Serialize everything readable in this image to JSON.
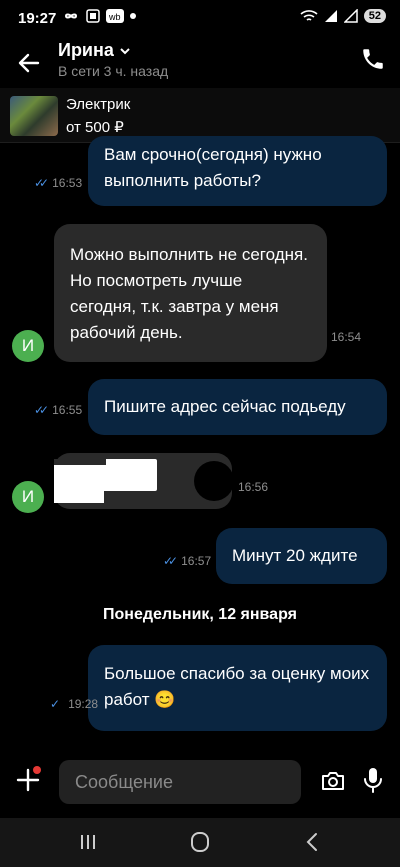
{
  "status_bar": {
    "time": "19:27",
    "battery": "52"
  },
  "header": {
    "name": "Ирина",
    "status": "В сети 3 ч. назад"
  },
  "listing": {
    "title": "Электрик",
    "price": "от 500 ₽"
  },
  "messages": [
    {
      "direction": "out",
      "text": "Вам срочно(сегодня) нужно выполнить работы?",
      "time": "16:53",
      "read": true
    },
    {
      "direction": "in",
      "text": "Можно выполнить не сегодня. Но посмотреть лучше сегодня, т.к. завтра у меня рабочий день.",
      "time": "16:54",
      "avatar": "И"
    },
    {
      "direction": "out",
      "text": "Пишите адрес сейчас подьеду",
      "time": "16:55",
      "read": true
    },
    {
      "direction": "in",
      "text": "",
      "time": "16:56",
      "avatar": "И",
      "redacted": true
    },
    {
      "direction": "out",
      "text": "Минут 20 ждите",
      "time": "16:57",
      "read": true
    },
    {
      "direction": "separator",
      "text": "Понедельник, 12 января"
    },
    {
      "direction": "out",
      "text": "Большое спасибо за оценку моих работ 😊",
      "time": "19:28",
      "read": false
    }
  ],
  "composer": {
    "placeholder": "Сообщение"
  },
  "colors": {
    "outgoing_bubble": "#0a2540",
    "incoming_bubble": "#2a2a2a",
    "avatar": "#4caf50",
    "check": "#4a90e2"
  }
}
